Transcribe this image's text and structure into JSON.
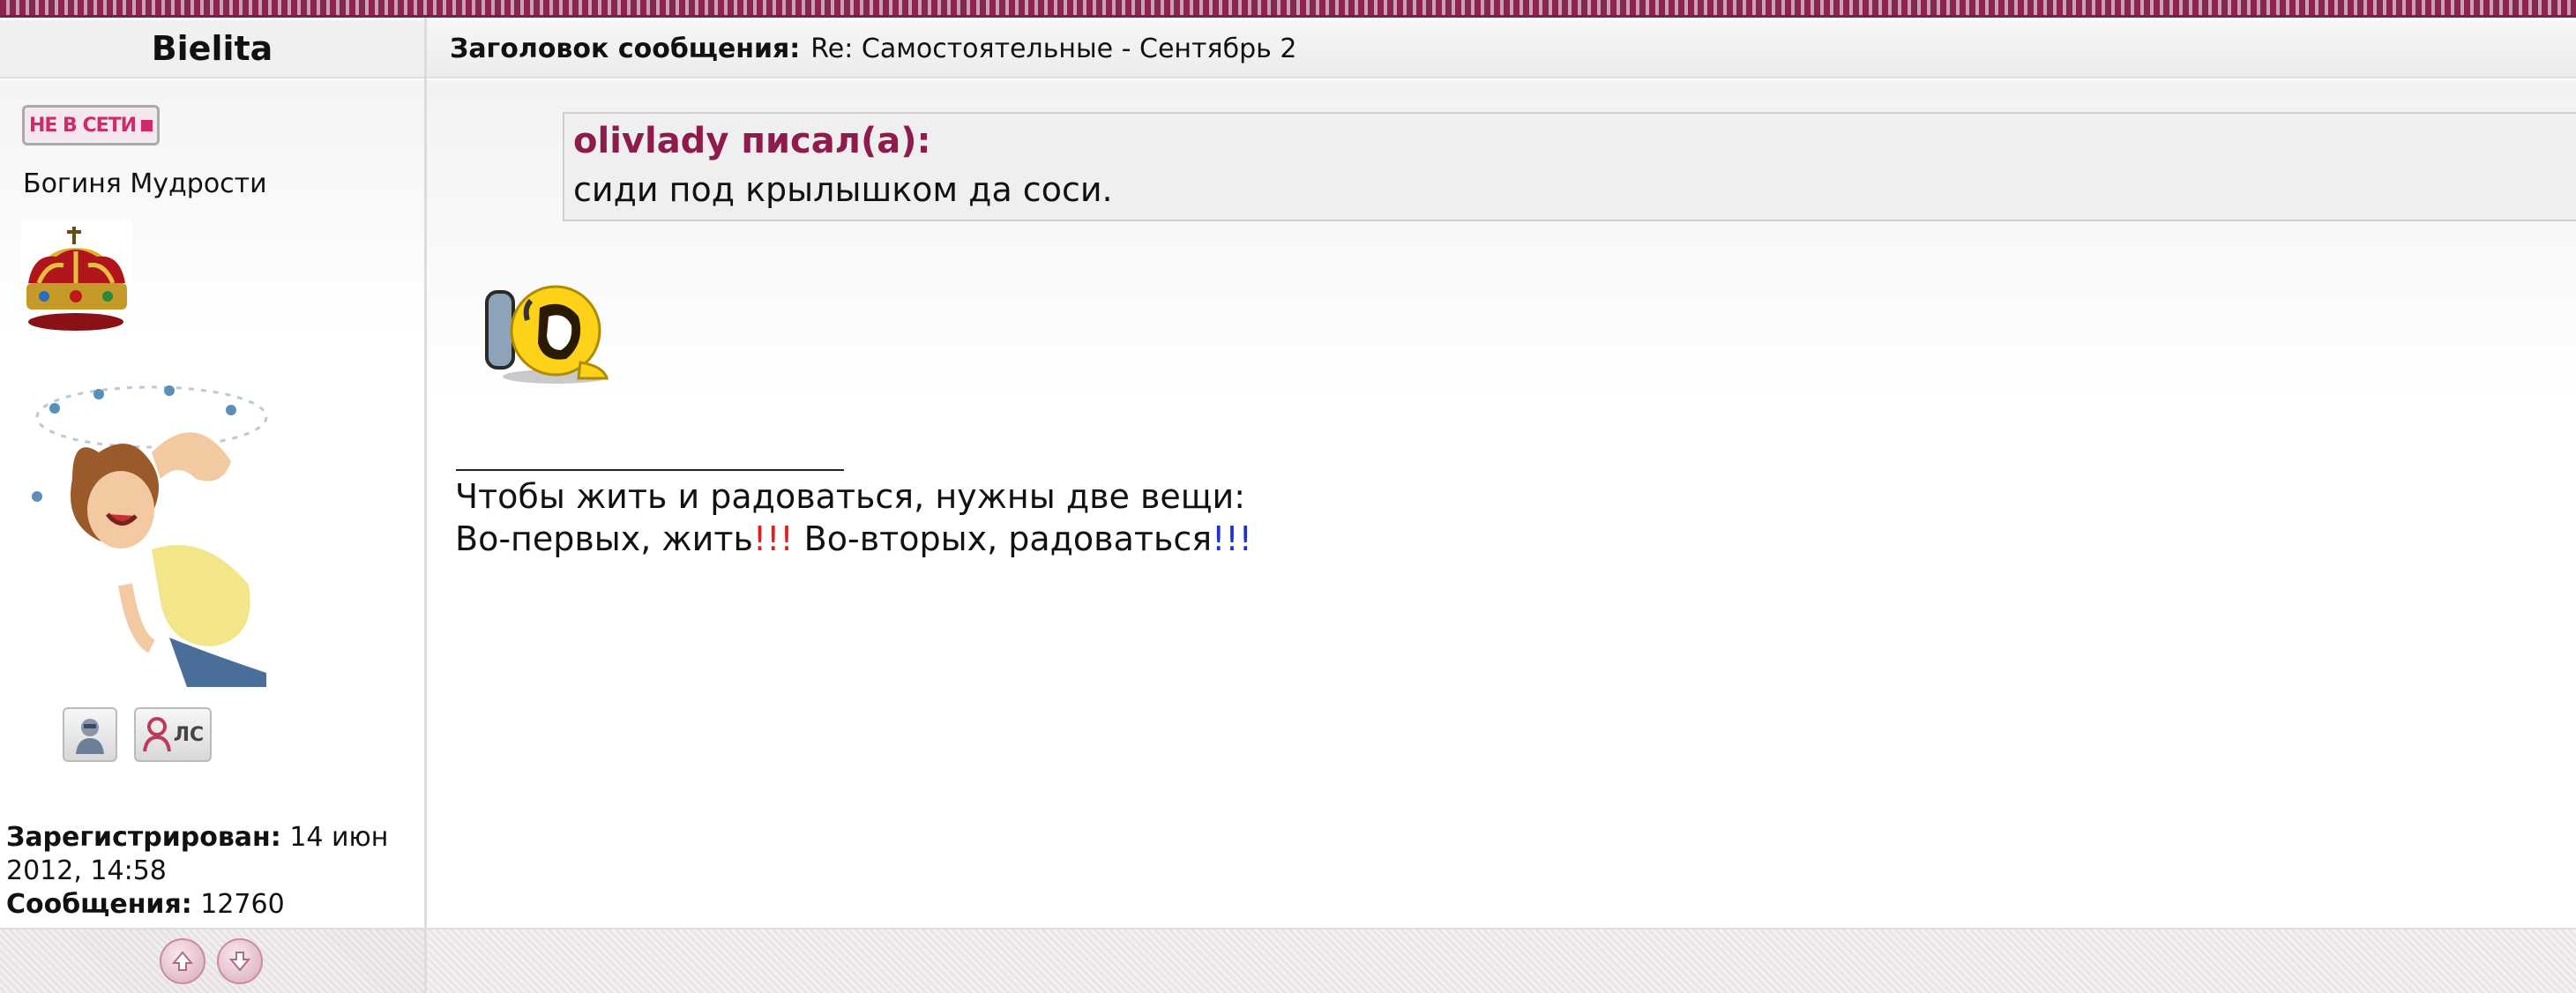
{
  "post": {
    "author": "Bielita",
    "subject_label": "Заголовок сообщения:",
    "subject": "Re: Самостоятельные - Сентябрь 2",
    "status_badge": "НЕ В СЕТИ",
    "rank": "Богиня Мудрости",
    "registered_label": "Зарегистрирован:",
    "registered_value": "14 июн 2012, 14:58",
    "messages_label": "Сообщения:",
    "messages_value": "12760",
    "pm_label": "ЛС",
    "quote": {
      "author": "olivlady писал(а):",
      "text": "сиди под крылышком да соси."
    },
    "signature": {
      "line1": "Чтобы жить и радоваться, нужны две вещи:",
      "line2_a": "Во-первых, жить",
      "line2_b": "!!!",
      "line2_c": " Во-вторых, радоваться",
      "line2_d": "!!!"
    }
  },
  "colors": {
    "accent": "#8d1b4c",
    "stripe": "#8a2450",
    "offline": "#d02a6a",
    "sig_red": "#e02020",
    "sig_blue": "#2030d0"
  },
  "icons": {
    "rank_image": "crown-icon",
    "avatar": "avatar-image",
    "profile": "profile-icon",
    "pm": "private-message-icon",
    "up": "arrow-up-icon",
    "down": "arrow-down-icon",
    "smiley": "laughing-smiley-icon"
  }
}
